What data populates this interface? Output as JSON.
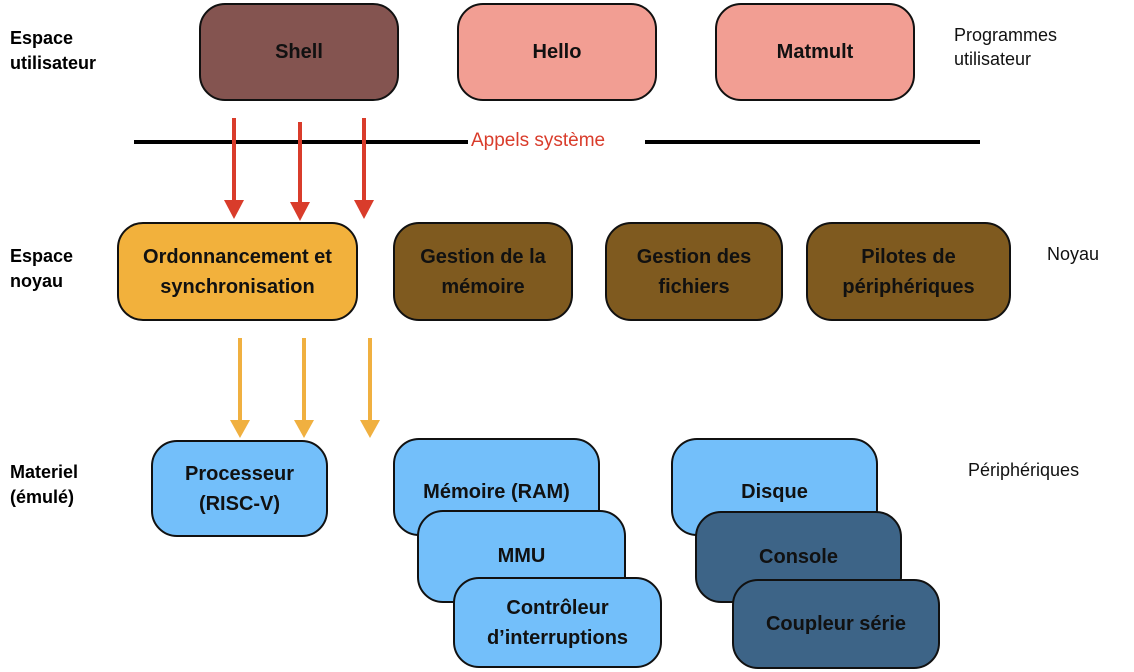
{
  "colors": {
    "shell": "#845450",
    "user_program": "#f29e93",
    "scheduler": "#f2b13c",
    "kernel": "#7f5a1f",
    "hardware_light": "#73bffa",
    "hardware_dark": "#3d6487",
    "syscall_arrow": "#d93c2b",
    "kernel_arrow": "#f0b040"
  },
  "layers": {
    "user": "Espace utilisateur",
    "kernel": "Espace noyau",
    "hardware": "Materiel (émulé)"
  },
  "notes": {
    "user": "Programmes utilisateur",
    "kernel": "Noyau",
    "hardware": "Périphériques"
  },
  "syscall_label": "Appels système",
  "user_programs": [
    "Shell",
    "Hello",
    "Matmult"
  ],
  "kernel_modules": [
    "Ordonnancement et synchronisation",
    "Gestion de la mémoire",
    "Gestion des fichiers",
    "Pilotes de périphériques"
  ],
  "hardware": {
    "processor": "Processeur (RISC-V)",
    "memory": "Mémoire (RAM)",
    "mmu": "MMU",
    "interrupt_controller": "Contrôleur d’interruptions",
    "disk": "Disque",
    "console": "Console",
    "serial": "Coupleur série"
  }
}
